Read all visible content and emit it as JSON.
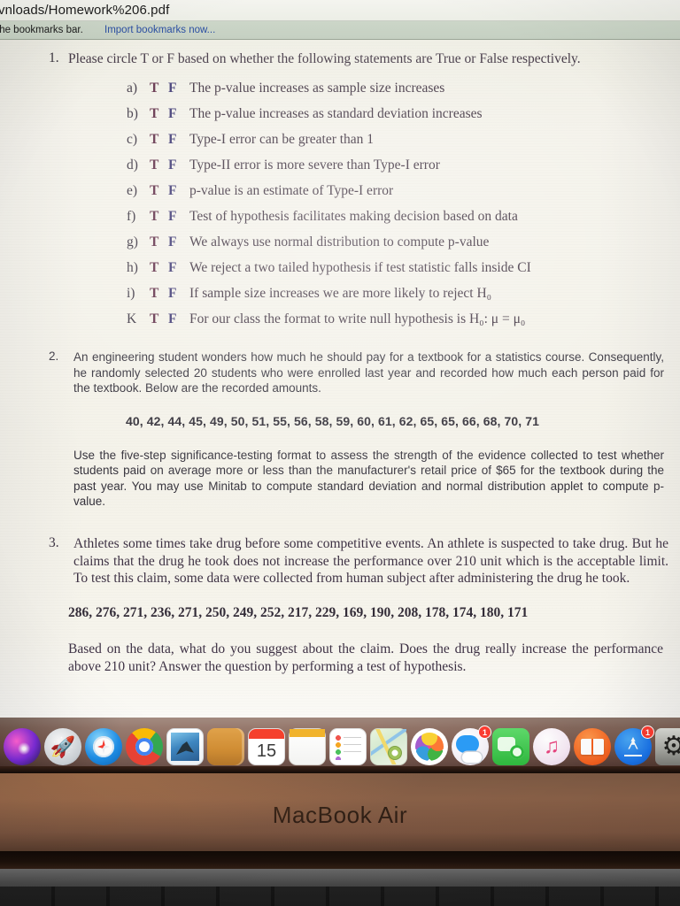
{
  "browser": {
    "url": "vnloads/Homework%206.pdf",
    "bookmarks_hint": "the bookmarks bar.",
    "bookmarks_link": "Import bookmarks now..."
  },
  "document": {
    "q1": {
      "number": "1.",
      "prompt": "Please circle T or F based on whether the following statements are True or False respectively.",
      "option_true": "T",
      "option_false": "F",
      "items": [
        {
          "letter": "a)",
          "text": "The p-value increases as sample size increases"
        },
        {
          "letter": "b)",
          "text": "The p-value increases as standard deviation increases"
        },
        {
          "letter": "c)",
          "text": "Type-I error can be greater than 1"
        },
        {
          "letter": "d)",
          "text": "Type-II error is more severe than Type-I error"
        },
        {
          "letter": "e)",
          "text": "p-value is an estimate of Type-I error"
        },
        {
          "letter": "f)",
          "text": "Test of hypothesis facilitates making decision based on data"
        },
        {
          "letter": "g)",
          "text": "We always use normal distribution to compute p-value"
        },
        {
          "letter": "h)",
          "text": "We reject a two tailed hypothesis if test statistic falls inside CI"
        },
        {
          "letter": "i)",
          "text": "If sample size increases we are more likely to reject H₀"
        },
        {
          "letter": "K",
          "text": "For our class the format to write null hypothesis is H₀: μ = μ₀"
        }
      ]
    },
    "q2": {
      "number": "2.",
      "para1": "An engineering student wonders how much he should pay for a textbook for a statistics course. Consequently, he randomly selected 20 students who were enrolled last year and recorded how much each person paid for the textbook. Below are the recorded amounts.",
      "data": "40, 42, 44, 45, 49, 50, 51, 55, 56, 58, 59, 60, 61, 62, 65, 65, 66, 68, 70, 71",
      "para2": "Use the five-step significance-testing format to assess the strength of the evidence collected to test whether students paid on average more or less than the manufacturer's retail price of $65 for the textbook during the past year. You may use Minitab to compute standard deviation and normal distribution applet to compute p-value."
    },
    "q3": {
      "number": "3.",
      "para1": "Athletes some times take drug before some competitive events. An athlete is suspected to take drug. But he claims that the drug he took does not increase the performance over 210 unit which is the acceptable limit.  To test this claim, some data were collected from human subject after administering the drug he took.",
      "data": "286, 276, 271, 236, 271, 250, 249, 252, 217, 229, 169, 190, 208, 178, 174, 180, 171",
      "para2": "Based on the data, what do you suggest about the claim. Does the drug really increase the performance above 210 unit? Answer the question by performing a test of hypothesis."
    }
  },
  "dock": {
    "items": [
      {
        "name": "siri-icon",
        "cls": "ic-siri round",
        "running": false,
        "badge": ""
      },
      {
        "name": "launchpad-icon",
        "cls": "ic-launchpad round",
        "running": false,
        "badge": ""
      },
      {
        "name": "safari-icon",
        "cls": "ic-safari round",
        "running": false,
        "badge": ""
      },
      {
        "name": "chrome-icon",
        "cls": "ic-chrome round",
        "running": true,
        "badge": ""
      },
      {
        "name": "mail-icon",
        "cls": "ic-mail",
        "running": false,
        "badge": ""
      },
      {
        "name": "notes-icon",
        "cls": "ic-notes",
        "running": false,
        "badge": ""
      },
      {
        "name": "calendar-icon",
        "cls": "ic-calendar",
        "running": false,
        "badge": "",
        "day": "15"
      },
      {
        "name": "pages-icon",
        "cls": "ic-pages",
        "running": false,
        "badge": ""
      },
      {
        "name": "reminders-icon",
        "cls": "ic-reminders",
        "running": false,
        "badge": ""
      },
      {
        "name": "maps-icon",
        "cls": "ic-maps",
        "running": false,
        "badge": ""
      },
      {
        "name": "photos-icon",
        "cls": "ic-photos round",
        "running": false,
        "badge": ""
      },
      {
        "name": "messages-icon",
        "cls": "ic-messages round",
        "running": true,
        "badge": "1"
      },
      {
        "name": "facetime-icon",
        "cls": "ic-facetime",
        "running": false,
        "badge": ""
      },
      {
        "name": "itunes-icon",
        "cls": "ic-itunes round",
        "running": false,
        "badge": ""
      },
      {
        "name": "books-icon",
        "cls": "ic-books round",
        "running": false,
        "badge": ""
      },
      {
        "name": "appstore-icon",
        "cls": "ic-appstore round",
        "running": false,
        "badge": "1"
      },
      {
        "name": "system-preferences-icon",
        "cls": "ic-sysprefs",
        "running": false,
        "badge": ""
      }
    ],
    "recent": {
      "name": "document-icon",
      "cls": "ic-doc"
    }
  },
  "device": {
    "label": "MacBook Air"
  }
}
